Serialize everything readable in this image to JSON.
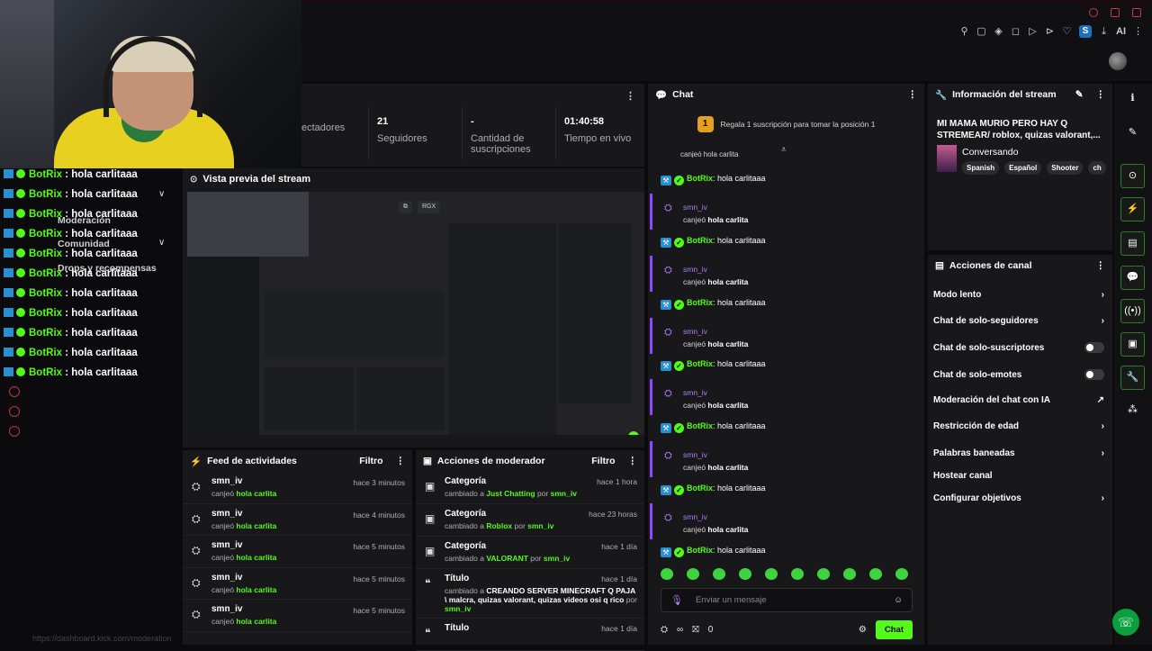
{
  "topbar": {
    "ai_label": "AI",
    "s_label": "S"
  },
  "stats": {
    "items": [
      {
        "label": "ectadores",
        "value": ""
      },
      {
        "label": "Seguidores",
        "value": "21"
      },
      {
        "label": "Cantidad de suscripciones",
        "value": "-"
      },
      {
        "label": "Tiempo en vivo",
        "value": "01:40:58"
      }
    ]
  },
  "preview": {
    "title": "Vista previa del stream",
    "rgx": "RGX"
  },
  "feed": {
    "title": "Feed de actividades",
    "filter": "Filtro",
    "rows": [
      {
        "user": "smn_iv",
        "time": "hace 3 minutos",
        "action": "canjeó",
        "reward": "hola carlita"
      },
      {
        "user": "smn_iv",
        "time": "hace 4 minutos",
        "action": "canjeó",
        "reward": "hola carlita"
      },
      {
        "user": "smn_iv",
        "time": "hace 5 minutos",
        "action": "canjeó",
        "reward": "hola carlita"
      },
      {
        "user": "smn_iv",
        "time": "hace 5 minutos",
        "action": "canjeó",
        "reward": "hola carlita"
      },
      {
        "user": "smn_iv",
        "time": "hace 5 minutos",
        "action": "canjeó",
        "reward": "hola carlita"
      }
    ]
  },
  "modactions": {
    "title": "Acciones de moderador",
    "filter": "Filtro",
    "rows": [
      {
        "title": "Categoría",
        "time": "hace 1 hora",
        "pre": "cambiado a",
        "value": "Just Chatting",
        "by": "por",
        "user": "smn_iv"
      },
      {
        "title": "Categoría",
        "time": "hace 23 horas",
        "pre": "cambiado a",
        "value": "Roblox",
        "by": "por",
        "user": "smn_iv"
      },
      {
        "title": "Categoría",
        "time": "hace 1 día",
        "pre": "cambiado a",
        "value": "VALORANT",
        "by": "por",
        "user": "smn_iv"
      },
      {
        "title": "Título",
        "time": "hace 1 día",
        "pre": "cambiado a",
        "value": "CREANDO SERVER MINECRAFT Q PAJA \\ malcra, quizas valorant, quizas videos osi q rico",
        "by": "por",
        "user": "smn_iv"
      },
      {
        "title": "Título",
        "time": "hace 1 día"
      }
    ]
  },
  "chat": {
    "title": "Chat",
    "banner": "Regala 1 suscripción para tomar la posición 1",
    "banner_badge": "1",
    "bot_name": "BotRix",
    "bot_text": ": hola carlitaaa",
    "redeem_user": "smn_iv",
    "redeem_action": "canjeó",
    "redeem_reward": "hola carlita",
    "top_cut": "canjeó hola carlita",
    "input_placeholder": "Enviar un mensaje",
    "viewers": "∞",
    "count": "0",
    "send": "Chat"
  },
  "streaminfo": {
    "title": "Información del stream",
    "stream_title": "MI MAMA MURIO PERO HAY Q STREMEAR/ roblox, quizas valorant,...",
    "category": "Conversando",
    "tags": [
      "Spanish",
      "Español",
      "Shooter",
      "ch"
    ]
  },
  "chanactions": {
    "title": "Acciones de canal",
    "items": [
      "Modo lento",
      "Chat de solo-seguidores",
      "Chat de solo-suscriptores",
      "Chat de solo-emotes",
      "Moderación del chat con IA",
      "Restricción de edad",
      "Palabras baneadas",
      "Hostear canal",
      "Configurar objetivos"
    ]
  },
  "overlay": {
    "bot": "BotRix",
    "text": " : hola carlitaaa"
  },
  "leftnav": {
    "moderacion": "Moderación",
    "comunidad": "Comunidad",
    "drops": "Drops y recompensas",
    "url": "https://dashboard.kick.com/moderation"
  },
  "colors": {
    "accent": "#53fc18",
    "purple": "#9146ff",
    "bg": "#0b0b0d",
    "panel": "#18181b"
  }
}
